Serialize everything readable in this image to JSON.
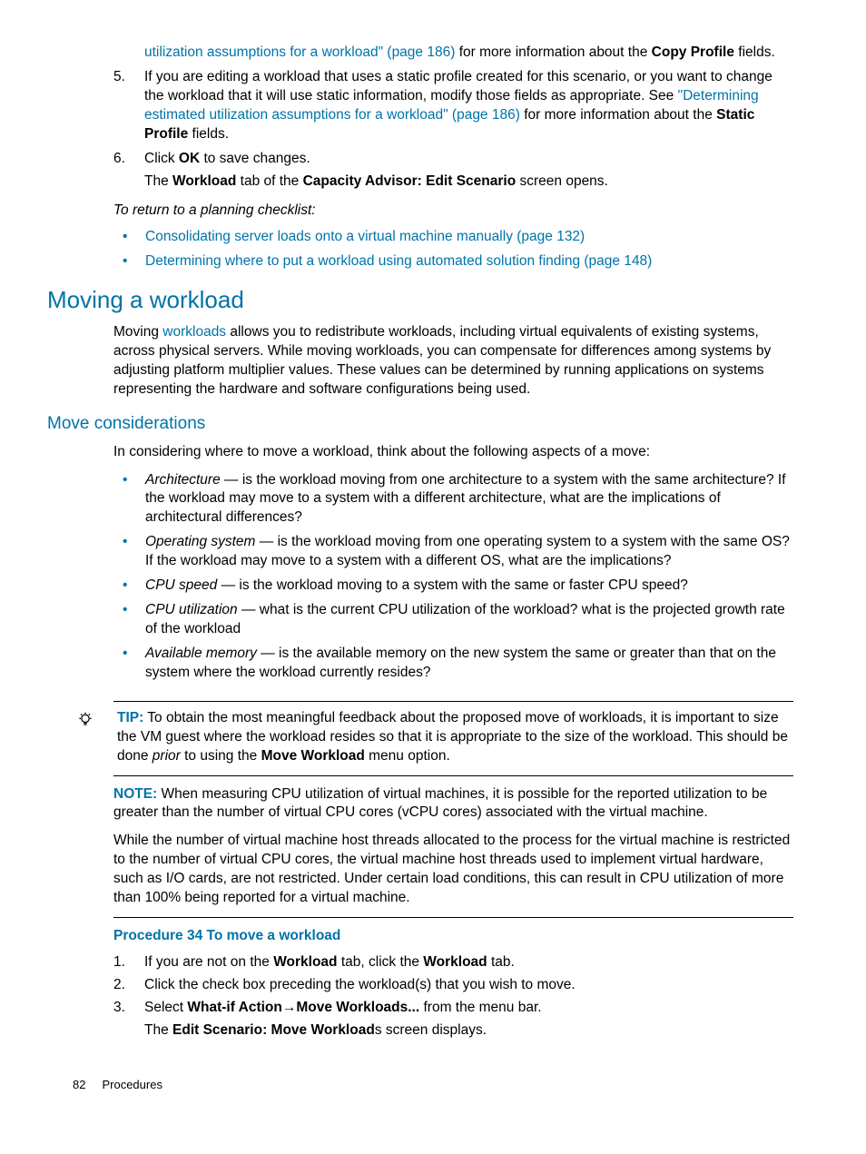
{
  "top_list": {
    "item4_tail": {
      "link": "utilization assumptions for a workload\" (page 186)",
      "after": " for more information about the ",
      "bold": "Copy Profile",
      "end": " fields."
    },
    "item5": {
      "num": "5.",
      "t1": "If you are editing a workload that uses a static profile created for this scenario, or you want to change the workload that it will use static information, modify those fields as appropriate. See ",
      "link": "\"Determining estimated utilization assumptions for a workload\" (page 186)",
      "t2": " for more information about the ",
      "bold": "Static Profile",
      "t3": " fields."
    },
    "item6": {
      "num": "6.",
      "t1": "Click ",
      "bold1": "OK",
      "t2": "  to save changes.",
      "sub_a": "The ",
      "sub_b": "Workload",
      "sub_c": " tab of the ",
      "sub_d": "Capacity Advisor: Edit Scenario",
      "sub_e": " screen opens."
    }
  },
  "checklist_intro": "To return to a planning checklist:",
  "checklist": {
    "i1": "Consolidating server loads onto a virtual machine manually (page 132)",
    "i2": "Determining where to put a workload using automated solution finding (page 148)"
  },
  "h1": "Moving a workload",
  "mw_para": {
    "a": "Moving ",
    "link": "workloads",
    "b": " allows you to redistribute workloads, including virtual equivalents of existing systems, across physical servers. While moving workloads, you can compensate for differences among systems by adjusting platform multiplier values. These values can be determined by running applications on systems representing the hardware and software configurations being used."
  },
  "h2": "Move considerations",
  "mc_intro": "In considering where to move a workload, think about the following aspects of a move:",
  "mc": {
    "arch_t": "Architecture",
    "arch": " — is the workload moving from one architecture to a system with the same architecture? If the workload may move to a system with a different architecture, what are the implications of architectural differences?",
    "os_t": "Operating system",
    "os": " — is the workload moving from one operating system to a system with the same OS? If the workload may move to a system with a different OS, what are the implications?",
    "cpu_t": "CPU speed",
    "cpu": " — is the workload moving to a system with the same or faster CPU speed?",
    "util_t": "CPU utilization",
    "util": " — what is the current CPU utilization of the workload? what is the projected growth rate of the workload",
    "mem_t": "Available memory",
    "mem": " — is the available memory on the new system the same or greater than that on the system where the workload currently resides?"
  },
  "tip": {
    "label": "TIP:",
    "a": "   To obtain the most meaningful feedback about the proposed move of workloads, it is important to size the VM guest where the workload resides so that it is appropriate to the size of the workload. This should be done ",
    "prior": "prior",
    "b": " to using the ",
    "bold": "Move Workload",
    "c": " menu option."
  },
  "note": {
    "label": "NOTE:",
    "p1": "   When measuring CPU utilization of virtual machines, it is possible for the reported utilization to be greater than the number of virtual CPU cores (vCPU cores) associated with the virtual machine.",
    "p2": "While the number of virtual machine host threads allocated to the process for the virtual machine is restricted to the number of virtual CPU cores, the virtual machine host threads used to implement virtual hardware, such as I/O cards, are not restricted. Under certain load conditions, this can result in CPU utilization of more than 100% being reported for a virtual machine."
  },
  "proc_title": "Procedure 34 To move a workload",
  "proc": {
    "i1": {
      "n": "1.",
      "a": "If you are not on the ",
      "b1": "Workload",
      "b": " tab, click the ",
      "b2": "Workload",
      "c": " tab."
    },
    "i2": {
      "n": "2.",
      "t": "Click the check box preceding the workload(s) that you wish to move."
    },
    "i3": {
      "n": "3.",
      "a": "Select ",
      "b1": "What-if Action",
      "arrow": "→",
      "b2": "Move Workloads...",
      "c": " from the menu bar.",
      "sub_a": "The ",
      "sub_b": "Edit Scenario: Move Workload",
      "sub_c": "s screen displays."
    }
  },
  "footer": {
    "page": "82",
    "section": "Procedures"
  }
}
